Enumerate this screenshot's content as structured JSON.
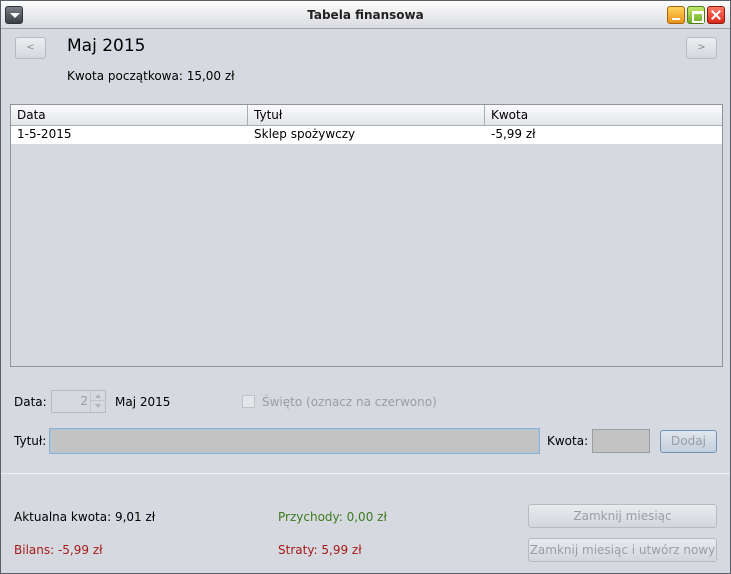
{
  "window": {
    "title": "Tabela finansowa"
  },
  "nav": {
    "prev_label": "<",
    "next_label": ">"
  },
  "header": {
    "month_title": "Maj 2015",
    "start_amount": "Kwota początkowa: 15,00 zł"
  },
  "table": {
    "columns": [
      "Data",
      "Tytuł",
      "Kwota"
    ],
    "rows": [
      {
        "date": "1-5-2015",
        "title": "Sklep spożywczy",
        "amount": "-5,99 zł"
      }
    ]
  },
  "form": {
    "date_label": "Data:",
    "day_value": "2",
    "month_label": "Maj 2015",
    "holiday_label": "Święto (oznacz na czerwono)",
    "holiday_checked": false,
    "title_label": "Tytuł:",
    "title_value": "",
    "amount_label": "Kwota:",
    "amount_value": "",
    "add_label": "Dodaj"
  },
  "summary": {
    "current_amount": "Aktualna kwota: 9,01 zł",
    "income": "Przychody: 0,00 zł",
    "balance": "Bilans: -5,99 zł",
    "losses": "Straty: 5,99 zł",
    "close_month_label": "Zamknij miesiąc",
    "close_month_new_label": "Zamknij miesiąc i utwórz nowy"
  },
  "colors": {
    "income": "#3f7a1f",
    "negative": "#a51a1a",
    "window_bg": "#d6d9df"
  }
}
